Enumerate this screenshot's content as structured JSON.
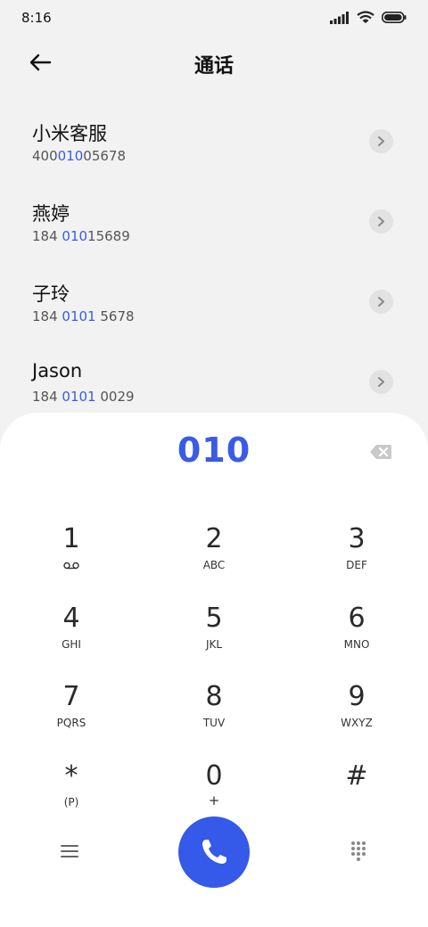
{
  "status_bar": {
    "time": "8:16"
  },
  "header": {
    "title": "通话"
  },
  "contacts": [
    {
      "name": "小米客服",
      "number_pre": "400",
      "number_match": "010",
      "number_post": "05678"
    },
    {
      "name": "燕婷",
      "number_pre": "184 ",
      "number_match": "010",
      "number_post": "15689"
    },
    {
      "name": "子玲",
      "number_pre": "184 ",
      "number_match": "0101",
      "number_post": " 5678"
    },
    {
      "name": "Jason",
      "number_pre": "184 ",
      "number_match": "0101",
      "number_post": " 0029"
    }
  ],
  "dialer": {
    "input": "010",
    "keys": [
      {
        "digit": "1",
        "letters": ""
      },
      {
        "digit": "2",
        "letters": "ABC"
      },
      {
        "digit": "3",
        "letters": "DEF"
      },
      {
        "digit": "4",
        "letters": "GHI"
      },
      {
        "digit": "5",
        "letters": "JKL"
      },
      {
        "digit": "6",
        "letters": "MNO"
      },
      {
        "digit": "7",
        "letters": "PQRS"
      },
      {
        "digit": "8",
        "letters": "TUV"
      },
      {
        "digit": "9",
        "letters": "WXYZ"
      },
      {
        "digit": "*",
        "letters": "(P)"
      },
      {
        "digit": "0",
        "letters": "+"
      },
      {
        "digit": "#",
        "letters": ""
      }
    ]
  },
  "colors": {
    "accent": "#3a5be8",
    "call_button": "#3559e8",
    "background": "#f2f2f2"
  },
  "icons": [
    "back-arrow-icon",
    "chevron-right-icon",
    "backspace-icon",
    "voicemail-icon",
    "menu-icon",
    "phone-icon",
    "keypad-icon",
    "signal-icon",
    "wifi-icon",
    "battery-icon"
  ]
}
